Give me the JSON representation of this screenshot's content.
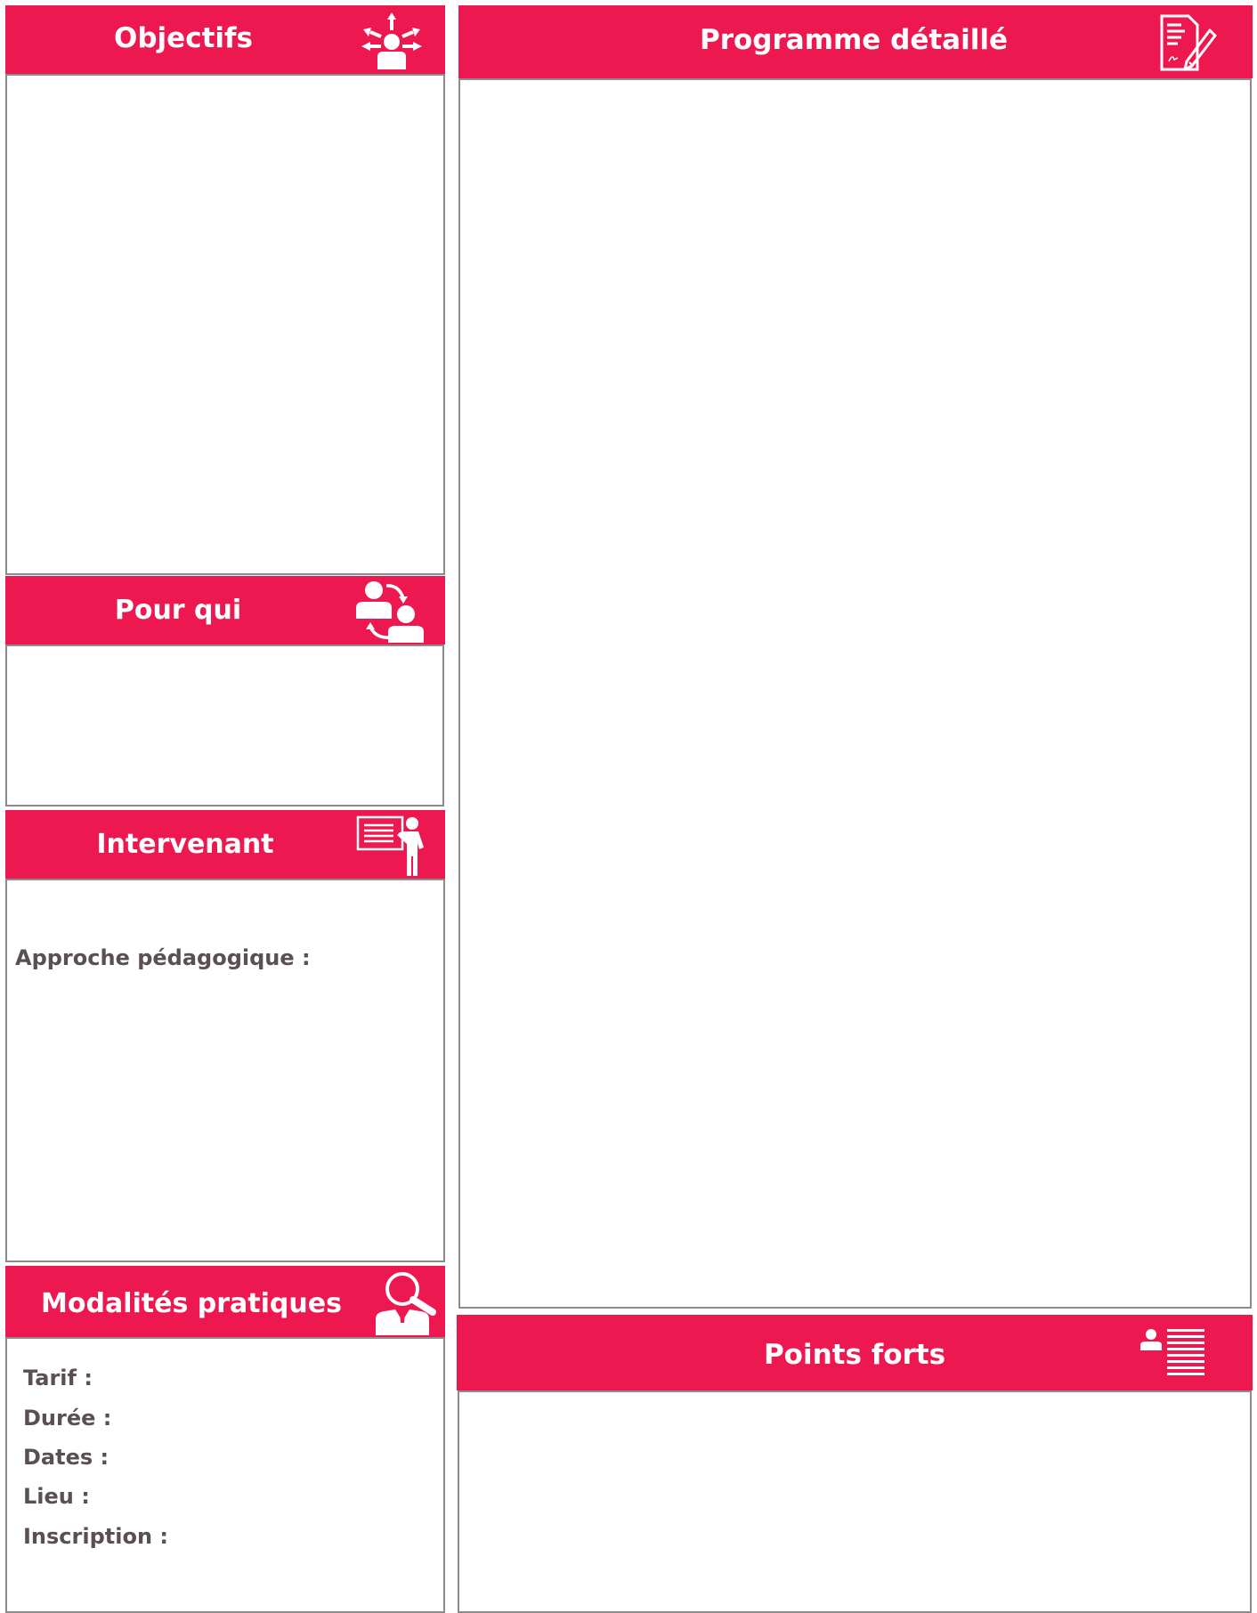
{
  "colors": {
    "header_bg": "#ee1850",
    "header_text": "#ffffff",
    "border": "#8c8c8c",
    "label_text": "#5a4f52"
  },
  "objectifs": {
    "title": "Objectifs",
    "icon": "goals-person-arrows-icon"
  },
  "programme": {
    "title": "Programme détaillé",
    "icon": "document-pen-icon"
  },
  "pour_qui": {
    "title": "Pour qui",
    "icon": "people-exchange-icon"
  },
  "intervenant": {
    "title": "Intervenant",
    "icon": "presenter-board-icon",
    "approche_label": "Approche pédagogique :"
  },
  "modalites": {
    "title": "Modalités pratiques",
    "icon": "person-magnifier-icon",
    "fields": [
      "Tarif :",
      "Durée :",
      "Dates :",
      "Lieu :",
      "Inscription :"
    ]
  },
  "points_forts": {
    "title": "Points forts",
    "icon": "person-list-icon"
  }
}
